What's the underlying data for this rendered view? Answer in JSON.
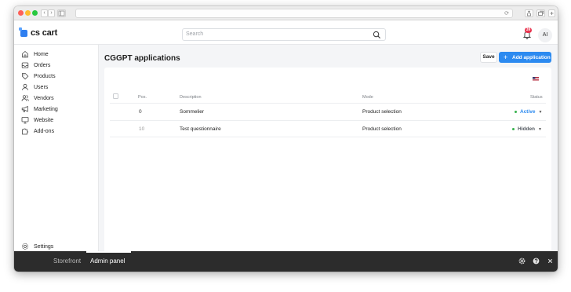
{
  "browser": {
    "nav_back": "‹",
    "nav_forward": "›",
    "reload_icon": "⟳"
  },
  "header": {
    "logo_text": "cs cart",
    "search_placeholder": "Search",
    "notification_count": "39",
    "avatar_initials": "AI"
  },
  "sidebar": {
    "items": [
      {
        "label": "Home",
        "icon": "home-icon"
      },
      {
        "label": "Orders",
        "icon": "inbox-icon"
      },
      {
        "label": "Products",
        "icon": "tag-icon"
      },
      {
        "label": "Users",
        "icon": "user-icon"
      },
      {
        "label": "Vendors",
        "icon": "users-icon"
      },
      {
        "label": "Marketing",
        "icon": "megaphone-icon"
      },
      {
        "label": "Website",
        "icon": "monitor-icon"
      },
      {
        "label": "Add-ons",
        "icon": "puzzle-icon"
      }
    ],
    "settings_label": "Settings"
  },
  "main": {
    "page_title": "CGGPT applications",
    "save_label": "Save",
    "add_label": "Add application",
    "table": {
      "columns": {
        "pos": "Pos.",
        "description": "Description",
        "mode": "Mode",
        "status": "Status"
      },
      "rows": [
        {
          "pos": "0",
          "description": "Sommelier",
          "mode": "Product selection",
          "status": "Active",
          "status_color": "#2c8af0"
        },
        {
          "pos": "10",
          "description": "Test questionnaire",
          "mode": "Product selection",
          "status": "Hidden",
          "status_color": "#555b62"
        }
      ]
    }
  },
  "bottom_bar": {
    "storefront_label": "Storefront",
    "admin_label": "Admin panel"
  },
  "colors": {
    "accent": "#2c8af0",
    "active_dot": "#37b24d",
    "hidden_dot": "#37b24d",
    "badge": "#e8344e"
  }
}
